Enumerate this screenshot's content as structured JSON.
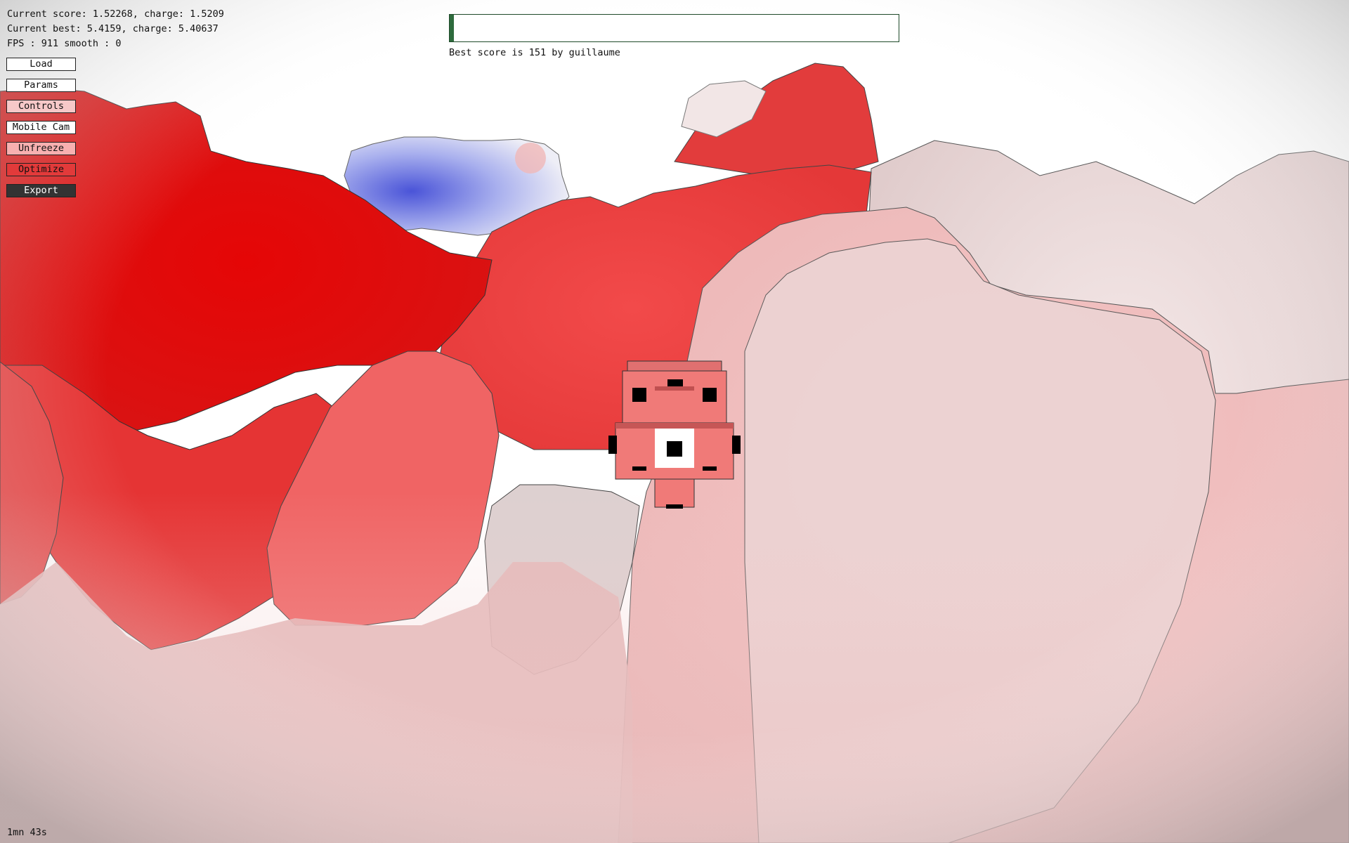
{
  "hud": {
    "score_line": "Current score: 1.52268, charge: 1.5209",
    "best_line": "Current best: 5.4159, charge: 5.40637",
    "fps_line": "FPS : 911 smooth : 0"
  },
  "menu": [
    {
      "name": "load-button",
      "label": "Load",
      "bg": "#ffffff",
      "fg": "#111111"
    },
    {
      "name": "params-button",
      "label": "Params",
      "bg": "#ffffff",
      "fg": "#111111"
    },
    {
      "name": "controls-button",
      "label": "Controls",
      "bg": "#f6c8c8",
      "fg": "#111111"
    },
    {
      "name": "mobile-cam-button",
      "label": "Mobile Cam",
      "bg": "#ffffff",
      "fg": "#111111"
    },
    {
      "name": "unfreeze-button",
      "label": "Unfreeze",
      "bg": "#f7b0b0",
      "fg": "#111111"
    },
    {
      "name": "optimize-button",
      "label": "Optimize",
      "bg": "#e23a3a",
      "fg": "#111111"
    },
    {
      "name": "export-button",
      "label": "Export",
      "bg": "#333333",
      "fg": "#ffffff"
    }
  ],
  "progress": {
    "fraction": 0.01,
    "color": "#2e6b3d"
  },
  "best_score_text": "Best score is 151 by guillaume",
  "timer": "1mn 43s",
  "colors": {
    "negative_charge": "#5a63e0",
    "positive_charge": "#e80808",
    "neutral": "#efe4e4",
    "ligand": "#f07a78"
  }
}
